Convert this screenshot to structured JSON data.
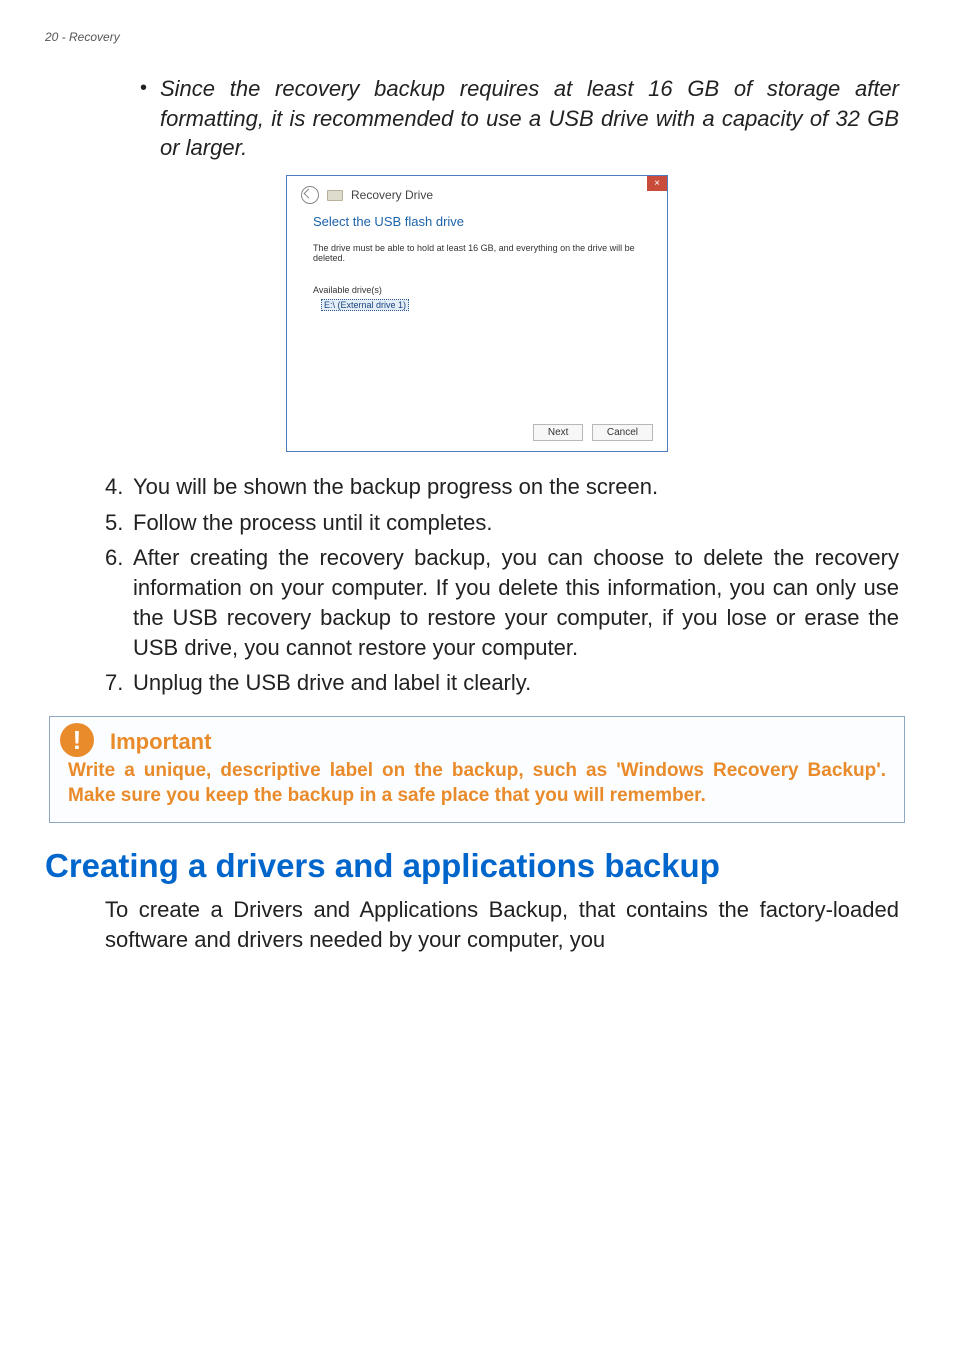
{
  "header": "20 - Recovery",
  "bullet": {
    "marker": "•",
    "text": "Since the recovery backup requires at least 16 GB of storage after formatting, it is recommended to use a USB drive with a capacity of 32 GB or larger."
  },
  "dialog": {
    "close_glyph": "×",
    "nav_title": "Recovery Drive",
    "heading": "Select the USB flash drive",
    "instruction": "The drive must be able to hold at least 16 GB, and everything on the drive will be deleted.",
    "available_label": "Available drive(s)",
    "drive_entry": "E:\\ (External drive 1)",
    "next_label": "Next",
    "cancel_label": "Cancel"
  },
  "steps": [
    {
      "num": "4.",
      "text": "You will be shown the backup progress on the screen."
    },
    {
      "num": "5.",
      "text": "Follow the process until it completes."
    },
    {
      "num": "6.",
      "text": "After creating the recovery backup, you can choose to delete the recovery information on your computer. If you delete this information, you can only use the USB recovery backup to restore your computer, if you lose or erase the USB drive, you cannot restore your computer."
    },
    {
      "num": "7.",
      "text": "Unplug the USB drive and label it clearly."
    }
  ],
  "important": {
    "icon_glyph": "!",
    "title": "Important",
    "body": "Write a unique, descriptive label on the backup, such as 'Windows Recovery Backup'. Make sure you keep the backup in a safe place that you will remember."
  },
  "section": {
    "heading": "Creating a drivers and applications backup",
    "body": "To create a Drivers and Applications Backup, that contains the factory-loaded software and drivers needed by your computer, you"
  }
}
